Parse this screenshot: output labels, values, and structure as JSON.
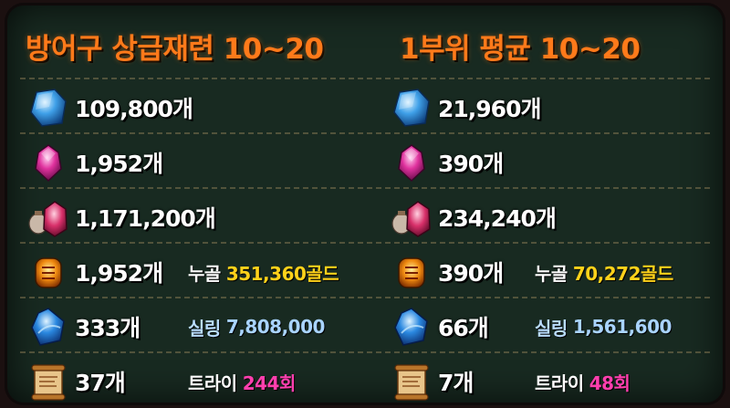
{
  "left_title": "방어구 상급재련 10~20",
  "right_title": "1부위 평균 10~20",
  "left_column": [
    {
      "icon": "guardian-stone-icon",
      "qty": "109,800개"
    },
    {
      "icon": "destruction-crystal-icon",
      "qty": "1,952개"
    },
    {
      "icon": "honor-shard-pouch-icon",
      "qty": "1,171,200개"
    },
    {
      "icon": "fusion-material-icon",
      "qty": "1,952개",
      "extra_label": "누골",
      "extra_value": "351,360골드"
    },
    {
      "icon": "blue-gem-icon",
      "qty": "333개",
      "extra_label": "실링",
      "extra_value": "7,808,000"
    },
    {
      "icon": "scroll-icon",
      "qty": "37개",
      "extra_label": "트라이",
      "extra_value": "244회"
    }
  ],
  "right_column": [
    {
      "icon": "guardian-stone-icon",
      "qty": "21,960개"
    },
    {
      "icon": "destruction-crystal-icon",
      "qty": "390개"
    },
    {
      "icon": "honor-shard-pouch-icon",
      "qty": "234,240개"
    },
    {
      "icon": "fusion-material-icon",
      "qty": "390개",
      "extra_label": "누골",
      "extra_value": "70,272골드"
    },
    {
      "icon": "blue-gem-icon",
      "qty": "66개",
      "extra_label": "실링",
      "extra_value": "1,561,600"
    },
    {
      "icon": "scroll-icon",
      "qty": "7개",
      "extra_label": "트라이",
      "extra_value": "48회"
    }
  ],
  "colors": {
    "title": "#ff7a1a",
    "board": "#182a21",
    "gold_value": "#ffd21a",
    "silver_value": "#a9d4ff",
    "try_value": "#ff3fae"
  }
}
